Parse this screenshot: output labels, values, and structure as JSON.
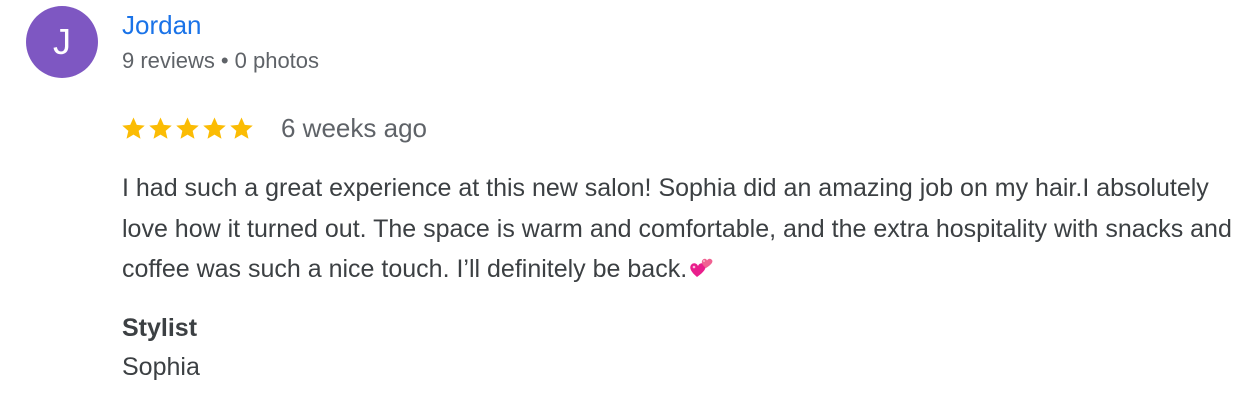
{
  "review": {
    "author": {
      "initial": "J",
      "name": "Jordan",
      "reviews_count": "9 reviews",
      "separator": "•",
      "photos_count": "0 photos",
      "avatar_color": "#7e57c2",
      "name_color": "#1a73e8"
    },
    "rating": {
      "stars": 5,
      "max_stars": 5,
      "star_color": "#fbbc04",
      "icon": "star-icon"
    },
    "time_ago": "6 weeks ago",
    "text": "I had such a great experience at this new salon! Sophia did an amazing job on my hair.I absolutely love how it turned out. The space is warm and comfortable, and the extra hospitality with snacks and coffee was such a nice touch. I’ll definitely be back.",
    "text_emoji": "two-hearts-emoji",
    "attributes": [
      {
        "label": "Stylist",
        "value": "Sophia"
      }
    ]
  }
}
